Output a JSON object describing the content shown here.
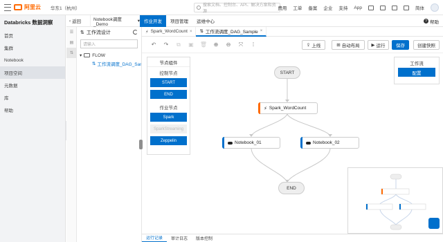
{
  "topbar": {
    "logo": "阿里云",
    "region": "华东1（杭州）",
    "search_placeholder": "搜索文档、控制台、API、解决方案和资源",
    "nav": [
      "费用",
      "工单",
      "备案",
      "企业",
      "支持",
      "App"
    ],
    "language": "简体"
  },
  "leftnav": {
    "title": "Databricks 数据洞察",
    "items": [
      {
        "label": "首页"
      },
      {
        "label": "集群"
      },
      {
        "label": "Notebook"
      },
      {
        "label": "项目空间",
        "active": true
      },
      {
        "label": "元数据"
      },
      {
        "label": "库"
      },
      {
        "label": "帮助"
      }
    ]
  },
  "tabrow": {
    "back_label": "返回",
    "project": "Notebook调度_Demo",
    "tabs": [
      {
        "label": "作业开发",
        "active": true
      },
      {
        "label": "项目管理"
      },
      {
        "label": "运维中心"
      }
    ],
    "help": "帮助"
  },
  "tree": {
    "title": "工作流设计",
    "filter_placeholder": "请输入",
    "folder": "FLOW",
    "leaf": "工作流调度_DAG_Sample"
  },
  "editor_tabs": [
    {
      "label": "Spark_WordCount"
    },
    {
      "label": "工作流调度_DAG_Sample",
      "active": true
    }
  ],
  "toolbar": {
    "upload": "上线",
    "auto_layout": "自动布局",
    "run": "运行",
    "save": "保存",
    "snapshot": "创建快照"
  },
  "palette": {
    "title": "节点组件",
    "control_section": "控制节点",
    "control_nodes": [
      "START",
      "END"
    ],
    "job_section": "作业节点",
    "job_nodes": [
      {
        "label": "Spark",
        "enabled": true
      },
      {
        "label": "SparkStreaming",
        "enabled": false
      },
      {
        "label": "Zeppelin",
        "enabled": true
      }
    ]
  },
  "props": {
    "title": "工作流",
    "config": "配置"
  },
  "workflow": {
    "start": "START",
    "end": "END",
    "nodes": [
      {
        "label": "Spark_WordCount",
        "color": "#ff6a00"
      },
      {
        "label": "Notebook_01",
        "color": "#0070cc"
      },
      {
        "label": "Notebook_02",
        "color": "#0070cc"
      }
    ]
  },
  "bottom_tabs": [
    {
      "label": "运行记录",
      "active": true
    },
    {
      "label": "审计日志"
    },
    {
      "label": "版本控制"
    }
  ],
  "colors": {
    "accent": "#0070cc",
    "brand": "#ff6a00"
  }
}
